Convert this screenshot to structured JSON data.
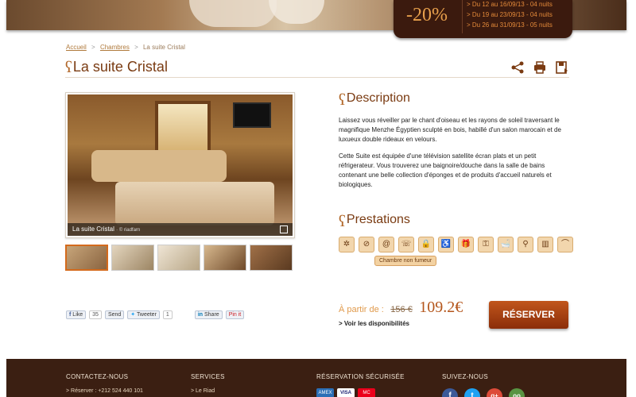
{
  "promo": {
    "discount": "-20%",
    "offers": [
      "> Du 12 au 16/09/13 - 04 nuits",
      "> Du 19 au 23/09/13 - 04 nuits",
      "> Du 26 au 31/09/13 - 05 nuits"
    ]
  },
  "breadcrumb": {
    "items": [
      "Accueil",
      "Chambres",
      "La suite Cristal"
    ],
    "separator": ">"
  },
  "page": {
    "title": "La suite Cristal"
  },
  "tools": {
    "icons": [
      "share-icon",
      "print-icon",
      "save-icon"
    ]
  },
  "gallery": {
    "caption": "La suite Cristal",
    "credit": "· © riadfarn",
    "thumb_count": 5
  },
  "description": {
    "title": "Description",
    "paragraphs": [
      "Laissez vous réveiller par le chant d'oiseau et les rayons de soleil traversant le magnifique Menzhe Égyptien sculpté en bois, habillé d'un salon marocain et de luxueux double rideaux en velours.",
      "Cette Suite est équipée d'une télévision satellite écran plats et un petit réfrigerateur. Vous trouverez une baignoire/douche dans la salle de bains contenant une belle collection d'éponges et de produits d'accueil naturels et biologiques."
    ]
  },
  "prestations": {
    "title": "Prestations",
    "icons": [
      "fan-icon",
      "no-smoking-icon",
      "internet-icon",
      "phone-icon",
      "safe-icon",
      "accessibility-icon",
      "gift-icon",
      "key-icon",
      "bathtub-icon",
      "shower-icon",
      "minibar-icon",
      "hanger-icon"
    ],
    "glyphs": [
      "✲",
      "⊘",
      "@",
      "☏",
      "🔒",
      "♿",
      "🎁",
      "⚿",
      "🛁",
      "⚲",
      "▥",
      "⌒"
    ],
    "tooltip": "Chambre non fumeur"
  },
  "social": {
    "like": "Like",
    "like_count": "35",
    "send": "Send",
    "tweet": "Tweeter",
    "tweet_count": "1",
    "share": "Share",
    "pin": "Pin it"
  },
  "booking": {
    "price_label": "À partir de :",
    "old_price": "156 €",
    "new_price": "109.2€",
    "availability": "> Voir les disponibilités",
    "reserve": "RÉSERVER"
  },
  "footer": {
    "contact_title": "CONTACTEZ-NOUS",
    "contact_line": "> Réserver : +212 524 440 101",
    "services_title": "SERVICES",
    "services_line": "> Le Riad",
    "secure_title": "RÉSERVATION SÉCURISÉE",
    "payments": [
      "AMEX",
      "VISA",
      "MC"
    ],
    "follow_title": "SUIVEZ-NOUS",
    "follow": [
      "f",
      "t",
      "g+",
      "oo"
    ]
  },
  "colors": {
    "accent": "#b4561c",
    "footer_bg": "#3b1f12",
    "title": "#7a3b12"
  }
}
